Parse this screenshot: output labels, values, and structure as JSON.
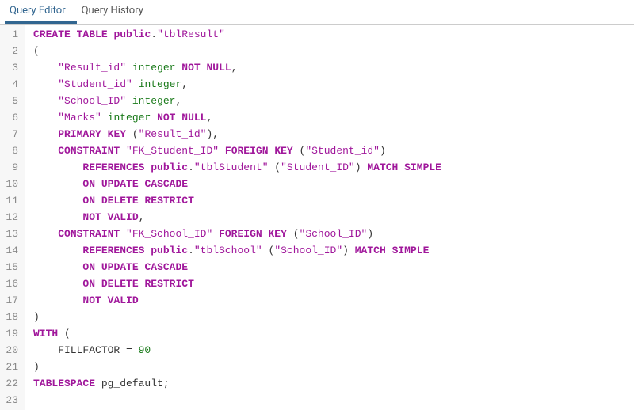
{
  "tabs": {
    "editor": "Query Editor",
    "history": "Query History"
  },
  "code": {
    "lines": [
      [
        [
          "kw",
          "CREATE"
        ],
        [
          "plain",
          " "
        ],
        [
          "kw",
          "TABLE"
        ],
        [
          "plain",
          " "
        ],
        [
          "kw",
          "public"
        ],
        [
          "plain",
          "."
        ],
        [
          "str",
          "\"tblResult\""
        ]
      ],
      [
        [
          "plain",
          "("
        ]
      ],
      [
        [
          "plain",
          "    "
        ],
        [
          "str",
          "\"Result_id\""
        ],
        [
          "plain",
          " "
        ],
        [
          "typ",
          "integer"
        ],
        [
          "plain",
          " "
        ],
        [
          "kw",
          "NOT"
        ],
        [
          "plain",
          " "
        ],
        [
          "kw",
          "NULL"
        ],
        [
          "plain",
          ","
        ]
      ],
      [
        [
          "plain",
          "    "
        ],
        [
          "str",
          "\"Student_id\""
        ],
        [
          "plain",
          " "
        ],
        [
          "typ",
          "integer"
        ],
        [
          "plain",
          ","
        ]
      ],
      [
        [
          "plain",
          "    "
        ],
        [
          "str",
          "\"School_ID\""
        ],
        [
          "plain",
          " "
        ],
        [
          "typ",
          "integer"
        ],
        [
          "plain",
          ","
        ]
      ],
      [
        [
          "plain",
          "    "
        ],
        [
          "str",
          "\"Marks\""
        ],
        [
          "plain",
          " "
        ],
        [
          "typ",
          "integer"
        ],
        [
          "plain",
          " "
        ],
        [
          "kw",
          "NOT"
        ],
        [
          "plain",
          " "
        ],
        [
          "kw",
          "NULL"
        ],
        [
          "plain",
          ","
        ]
      ],
      [
        [
          "plain",
          "    "
        ],
        [
          "kw",
          "PRIMARY"
        ],
        [
          "plain",
          " "
        ],
        [
          "kw",
          "KEY"
        ],
        [
          "plain",
          " ("
        ],
        [
          "str",
          "\"Result_id\""
        ],
        [
          "plain",
          "),"
        ]
      ],
      [
        [
          "plain",
          "    "
        ],
        [
          "kw",
          "CONSTRAINT"
        ],
        [
          "plain",
          " "
        ],
        [
          "str",
          "\"FK_Student_ID\""
        ],
        [
          "plain",
          " "
        ],
        [
          "kw",
          "FOREIGN"
        ],
        [
          "plain",
          " "
        ],
        [
          "kw",
          "KEY"
        ],
        [
          "plain",
          " ("
        ],
        [
          "str",
          "\"Student_id\""
        ],
        [
          "plain",
          ")"
        ]
      ],
      [
        [
          "plain",
          "        "
        ],
        [
          "kw",
          "REFERENCES"
        ],
        [
          "plain",
          " "
        ],
        [
          "kw",
          "public"
        ],
        [
          "plain",
          "."
        ],
        [
          "str",
          "\"tblStudent\""
        ],
        [
          "plain",
          " ("
        ],
        [
          "str",
          "\"Student_ID\""
        ],
        [
          "plain",
          ") "
        ],
        [
          "kw",
          "MATCH"
        ],
        [
          "plain",
          " "
        ],
        [
          "kw",
          "SIMPLE"
        ]
      ],
      [
        [
          "plain",
          "        "
        ],
        [
          "kw",
          "ON"
        ],
        [
          "plain",
          " "
        ],
        [
          "kw",
          "UPDATE"
        ],
        [
          "plain",
          " "
        ],
        [
          "kw",
          "CASCADE"
        ]
      ],
      [
        [
          "plain",
          "        "
        ],
        [
          "kw",
          "ON"
        ],
        [
          "plain",
          " "
        ],
        [
          "kw",
          "DELETE"
        ],
        [
          "plain",
          " "
        ],
        [
          "kw",
          "RESTRICT"
        ]
      ],
      [
        [
          "plain",
          "        "
        ],
        [
          "kw",
          "NOT"
        ],
        [
          "plain",
          " "
        ],
        [
          "kw",
          "VALID"
        ],
        [
          "plain",
          ","
        ]
      ],
      [
        [
          "plain",
          "    "
        ],
        [
          "kw",
          "CONSTRAINT"
        ],
        [
          "plain",
          " "
        ],
        [
          "str",
          "\"FK_School_ID\""
        ],
        [
          "plain",
          " "
        ],
        [
          "kw",
          "FOREIGN"
        ],
        [
          "plain",
          " "
        ],
        [
          "kw",
          "KEY"
        ],
        [
          "plain",
          " ("
        ],
        [
          "str",
          "\"School_ID\""
        ],
        [
          "plain",
          ")"
        ]
      ],
      [
        [
          "plain",
          "        "
        ],
        [
          "kw",
          "REFERENCES"
        ],
        [
          "plain",
          " "
        ],
        [
          "kw",
          "public"
        ],
        [
          "plain",
          "."
        ],
        [
          "str",
          "\"tblSchool\""
        ],
        [
          "plain",
          " ("
        ],
        [
          "str",
          "\"School_ID\""
        ],
        [
          "plain",
          ") "
        ],
        [
          "kw",
          "MATCH"
        ],
        [
          "plain",
          " "
        ],
        [
          "kw",
          "SIMPLE"
        ]
      ],
      [
        [
          "plain",
          "        "
        ],
        [
          "kw",
          "ON"
        ],
        [
          "plain",
          " "
        ],
        [
          "kw",
          "UPDATE"
        ],
        [
          "plain",
          " "
        ],
        [
          "kw",
          "CASCADE"
        ]
      ],
      [
        [
          "plain",
          "        "
        ],
        [
          "kw",
          "ON"
        ],
        [
          "plain",
          " "
        ],
        [
          "kw",
          "DELETE"
        ],
        [
          "plain",
          " "
        ],
        [
          "kw",
          "RESTRICT"
        ]
      ],
      [
        [
          "plain",
          "        "
        ],
        [
          "kw",
          "NOT"
        ],
        [
          "plain",
          " "
        ],
        [
          "kw",
          "VALID"
        ]
      ],
      [
        [
          "plain",
          ")"
        ]
      ],
      [
        [
          "kw",
          "WITH"
        ],
        [
          "plain",
          " ("
        ]
      ],
      [
        [
          "plain",
          "    FILLFACTOR = "
        ],
        [
          "num",
          "90"
        ]
      ],
      [
        [
          "plain",
          ")"
        ]
      ],
      [
        [
          "kw",
          "TABLESPACE"
        ],
        [
          "plain",
          " pg_default;"
        ]
      ],
      [
        [
          "plain",
          ""
        ]
      ]
    ]
  }
}
